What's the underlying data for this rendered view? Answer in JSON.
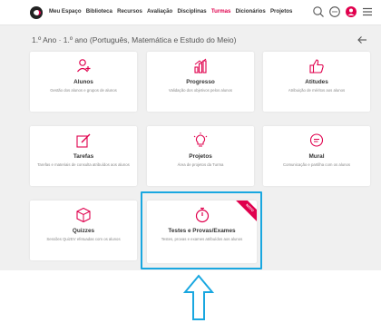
{
  "nav": {
    "items": [
      "Meu Espaço",
      "Biblioteca",
      "Recursos",
      "Avaliação",
      "Disciplinas",
      "Turmas",
      "Dicionários",
      "Projetos"
    ],
    "active_index": 5,
    "brand_color": "#e0004d"
  },
  "icons": {
    "logo": "logo-icon",
    "search": "search-icon",
    "chat": "chat-icon",
    "avatar": "avatar-icon",
    "menu": "menu-icon",
    "back": "arrow-left-icon",
    "highlight_arrow": "arrow-up-icon"
  },
  "breadcrumb": "1.º Ano · 1.º ano (Português, Matemática e Estudo do Meio)",
  "cards": [
    {
      "title": "Alunos",
      "desc": "Gestão dos alunos e grupos de alunos",
      "icon": "add-user-icon"
    },
    {
      "title": "Progresso",
      "desc": "Validação dos objetivos pelos alunos",
      "icon": "bar-chart-icon"
    },
    {
      "title": "Atitudes",
      "desc": "Atribuição de méritos aos alunos",
      "icon": "thumbs-up-icon"
    },
    {
      "title": "Tarefas",
      "desc": "Tarefas e materiais de consulta atribuídos aos alunos",
      "icon": "edit-icon"
    },
    {
      "title": "Projetos",
      "desc": "Área de projetos da Turma",
      "icon": "lightbulb-icon"
    },
    {
      "title": "Mural",
      "desc": "Comunicação e partilha com os alunos",
      "icon": "message-icon"
    },
    {
      "title": "Quizzes",
      "desc": "Sessões QuizEV efetuadas com os alunos",
      "icon": "cube-icon"
    },
    {
      "title": "Testes e Provas/Exames",
      "desc": "Testes, provas e exames atribuídos aos alunos",
      "icon": "stopwatch-icon",
      "badge": "NOVO"
    }
  ],
  "colors": {
    "highlight": "#19a7e0",
    "accent": "#e0004d"
  }
}
